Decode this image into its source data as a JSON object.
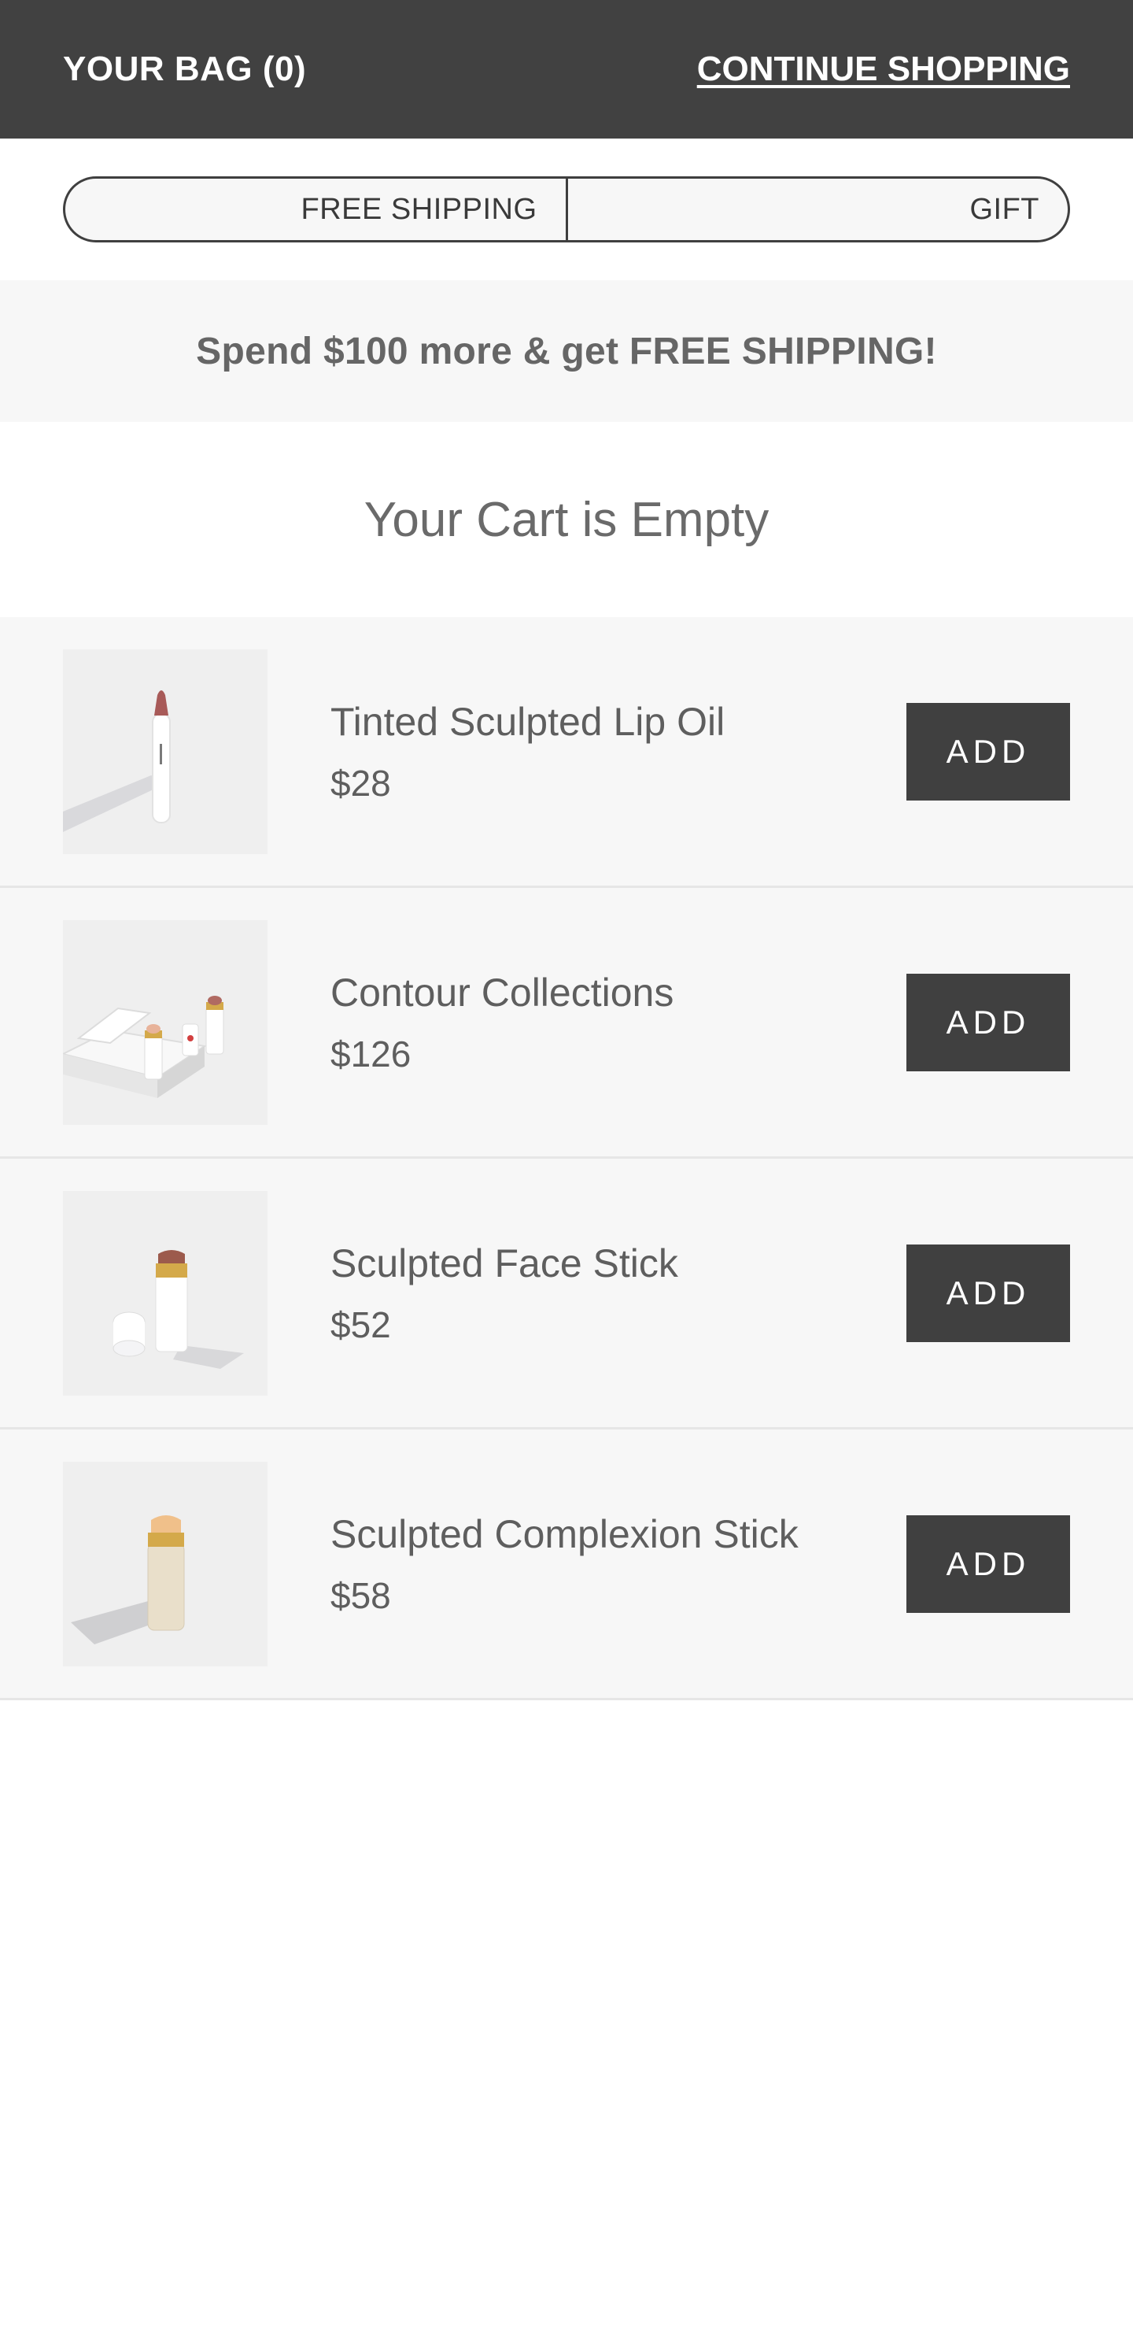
{
  "header": {
    "bag_title": "YOUR BAG (0)",
    "continue_link": "CONTINUE SHOPPING"
  },
  "progress": {
    "segments": [
      "FREE SHIPPING",
      "GIFT"
    ]
  },
  "promo": {
    "text": "Spend $100 more & get FREE SHIPPING!"
  },
  "cart": {
    "empty_message": "Your Cart is Empty"
  },
  "products": [
    {
      "name": "Tinted Sculpted Lip Oil",
      "price": "$28",
      "button": "ADD",
      "image_icon": "lip-oil-icon"
    },
    {
      "name": "Contour Collections",
      "price": "$126",
      "button": "ADD",
      "image_icon": "contour-set-icon"
    },
    {
      "name": "Sculpted Face Stick",
      "price": "$52",
      "button": "ADD",
      "image_icon": "face-stick-icon"
    },
    {
      "name": "Sculpted Complexion Stick",
      "price": "$58",
      "button": "ADD",
      "image_icon": "complexion-stick-icon"
    }
  ],
  "colors": {
    "header_bg": "#414141",
    "button_bg": "#404040",
    "row_bg": "#f7f7f7",
    "text": "#5e5e5e"
  }
}
